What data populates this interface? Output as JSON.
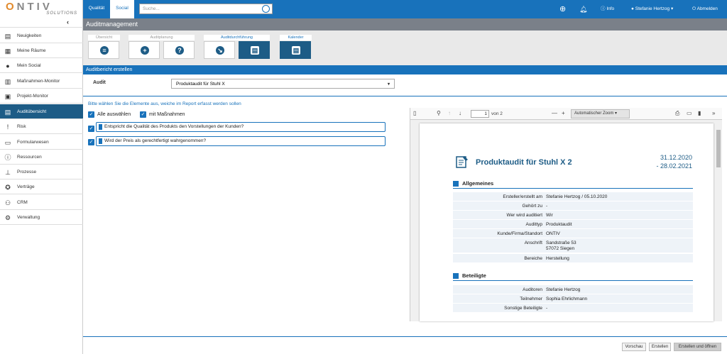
{
  "app": {
    "logo_text": "ONTIV",
    "logo_sub": "SOLUTIONS"
  },
  "sidebar": {
    "items": [
      {
        "label": "Neuigkeiten",
        "icon": "news-icon"
      },
      {
        "label": "Meine Räume",
        "icon": "grid-icon"
      },
      {
        "label": "Mein Social",
        "icon": "user-icon"
      },
      {
        "label": "Maßnahmen-Monitor",
        "icon": "bars-icon"
      },
      {
        "label": "Projekt-Monitor",
        "icon": "project-icon"
      },
      {
        "label": "Auditübersicht",
        "icon": "audit-icon"
      },
      {
        "label": "Risk",
        "icon": "risk-icon"
      },
      {
        "label": "Formularwesen",
        "icon": "form-icon"
      },
      {
        "label": "Ressourcen",
        "icon": "resources-icon"
      },
      {
        "label": "Prozesse",
        "icon": "process-icon"
      },
      {
        "label": "Verträge",
        "icon": "contract-icon"
      },
      {
        "label": "CRM",
        "icon": "crm-icon"
      },
      {
        "label": "Verwaltung",
        "icon": "gear-icon"
      }
    ],
    "active": "Auditübersicht"
  },
  "topbar": {
    "tabs": [
      "Qualität",
      "Social"
    ],
    "search_placeholder": "Suche...",
    "info": "Info",
    "user": "Stefanie Hertzog",
    "logout": "Abmelden"
  },
  "header": {
    "title": "Auditmanagement"
  },
  "toolbar": {
    "groups": [
      "Übersicht",
      "Auditplanung",
      "Auditdurchführung",
      "Kalender"
    ]
  },
  "section": {
    "title": "Auditbericht erstellen",
    "audit_label": "Audit",
    "audit_value": "Produktaudit für Stuhl X"
  },
  "selection": {
    "instruction": "Bitte wählen Sie die Elemente aus, weiche im Report erfasst werden sollen",
    "select_all": "Alle auswählen",
    "with_measures": "mit Maßnahmen",
    "items": [
      "Entspricht die Qualität des Produkts den Vorstellungen der Kunden?",
      "Wird der Preis als gerechtfertigt wahrgenommen?"
    ]
  },
  "pdf": {
    "page": "1",
    "of": "von 2",
    "zoom": "Automatischer Zoom",
    "title": "Produktaudit für Stuhl X 2",
    "date_from": "31.12.2020",
    "date_to": "- 28.02.2021",
    "general": {
      "heading": "Allgemeines",
      "rows": [
        {
          "k": "Ersteller/erstellt am",
          "v": "Stefanie Hertzog / 05.10.2020"
        },
        {
          "k": "Gehört zu",
          "v": "-"
        },
        {
          "k": "Wer wird auditiert",
          "v": "Wir"
        },
        {
          "k": "Audittyp",
          "v": "Produktaudit"
        },
        {
          "k": "Kunde/Firma/Standort",
          "v": "ONTIV"
        },
        {
          "k": "Anschrift",
          "v": "Sandstraße 53",
          "v2": "57072 Siegen"
        },
        {
          "k": "Bereiche",
          "v": "Herstellung"
        }
      ]
    },
    "participants": {
      "heading": "Beteiligte",
      "rows": [
        {
          "k": "Auditoren",
          "v": "Stefanie Hertzog"
        },
        {
          "k": "Teilnehmer",
          "v": "Sophia Ehrlichmann"
        },
        {
          "k": "Sonstige Beteiligte",
          "v": "-"
        }
      ]
    }
  },
  "buttons": {
    "preview": "Vorschau",
    "create": "Erstellen",
    "create_open": "Erstellen und öffnen"
  },
  "colors": {
    "primary": "#1872bb",
    "dark": "#1d5c86",
    "header_gray": "#7a8089"
  }
}
